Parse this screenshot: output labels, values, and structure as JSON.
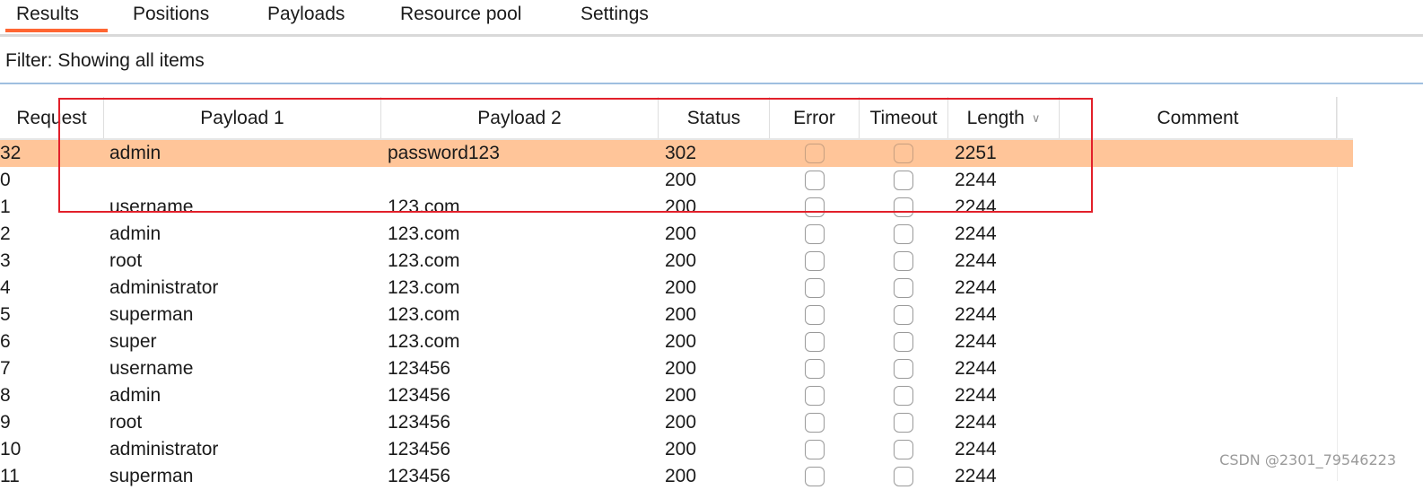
{
  "tabs": [
    {
      "label": "Results",
      "active": true
    },
    {
      "label": "Positions",
      "active": false
    },
    {
      "label": "Payloads",
      "active": false
    },
    {
      "label": "Resource pool",
      "active": false
    },
    {
      "label": "Settings",
      "active": false
    }
  ],
  "filter": {
    "text": "Filter: Showing all items"
  },
  "table": {
    "columns": [
      "Request",
      "Payload 1",
      "Payload 2",
      "Status",
      "Error",
      "Timeout",
      "Length",
      "Comment"
    ],
    "sorted_column": "Length",
    "sort_icon": "chevron-down-icon",
    "rows": [
      {
        "request": "32",
        "payload1": "admin",
        "payload2": "password123",
        "status": "302",
        "error": false,
        "timeout": false,
        "length": "2251",
        "comment": "",
        "highlighted": true
      },
      {
        "request": "0",
        "payload1": "",
        "payload2": "",
        "status": "200",
        "error": false,
        "timeout": false,
        "length": "2244",
        "comment": "",
        "highlighted": false
      },
      {
        "request": "1",
        "payload1": "username",
        "payload2": "123.com",
        "status": "200",
        "error": false,
        "timeout": false,
        "length": "2244",
        "comment": "",
        "highlighted": false
      },
      {
        "request": "2",
        "payload1": "admin",
        "payload2": "123.com",
        "status": "200",
        "error": false,
        "timeout": false,
        "length": "2244",
        "comment": "",
        "highlighted": false
      },
      {
        "request": "3",
        "payload1": "root",
        "payload2": "123.com",
        "status": "200",
        "error": false,
        "timeout": false,
        "length": "2244",
        "comment": "",
        "highlighted": false
      },
      {
        "request": "4",
        "payload1": "administrator",
        "payload2": "123.com",
        "status": "200",
        "error": false,
        "timeout": false,
        "length": "2244",
        "comment": "",
        "highlighted": false
      },
      {
        "request": "5",
        "payload1": "superman",
        "payload2": "123.com",
        "status": "200",
        "error": false,
        "timeout": false,
        "length": "2244",
        "comment": "",
        "highlighted": false
      },
      {
        "request": "6",
        "payload1": "super",
        "payload2": "123.com",
        "status": "200",
        "error": false,
        "timeout": false,
        "length": "2244",
        "comment": "",
        "highlighted": false
      },
      {
        "request": "7",
        "payload1": "username",
        "payload2": "123456",
        "status": "200",
        "error": false,
        "timeout": false,
        "length": "2244",
        "comment": "",
        "highlighted": false
      },
      {
        "request": "8",
        "payload1": "admin",
        "payload2": "123456",
        "status": "200",
        "error": false,
        "timeout": false,
        "length": "2244",
        "comment": "",
        "highlighted": false
      },
      {
        "request": "9",
        "payload1": "root",
        "payload2": "123456",
        "status": "200",
        "error": false,
        "timeout": false,
        "length": "2244",
        "comment": "",
        "highlighted": false
      },
      {
        "request": "10",
        "payload1": "administrator",
        "payload2": "123456",
        "status": "200",
        "error": false,
        "timeout": false,
        "length": "2244",
        "comment": "",
        "highlighted": false
      },
      {
        "request": "11",
        "payload1": "superman",
        "payload2": "123456",
        "status": "200",
        "error": false,
        "timeout": false,
        "length": "2244",
        "comment": "",
        "highlighted": false
      }
    ]
  },
  "colors": {
    "accent_tab": "#ff6633",
    "highlight_row": "#ffc599",
    "annotation_box": "#e2202a"
  },
  "watermark": "CSDN @2301_79546223"
}
